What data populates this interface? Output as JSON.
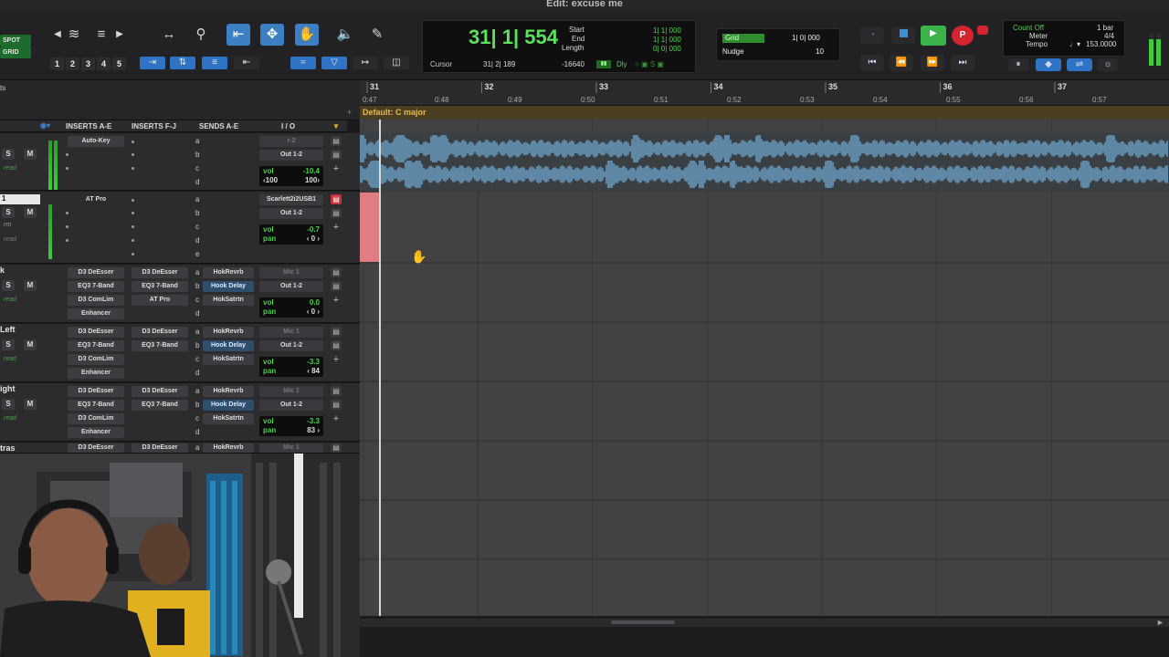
{
  "window": {
    "title": "Edit: excuse me"
  },
  "toolbar": {
    "modes": [
      "SPOT",
      "GRID"
    ],
    "zoom_presets": [
      "1",
      "2",
      "3",
      "4",
      "5"
    ]
  },
  "counter": {
    "main": "31| 1| 554",
    "start_label": "Start",
    "start_value": "1| 1| 000",
    "end_label": "End",
    "end_value": "1| 1| 000",
    "length_label": "Length",
    "length_value": "0| 0| 000",
    "cursor_label": "Cursor",
    "cursor_value": "31| 2| 189",
    "cursor_sample": "-16640",
    "dly_label": "Dly"
  },
  "grid": {
    "grid_label": "Grid",
    "grid_value": "1| 0| 000",
    "nudge_label": "Nudge",
    "nudge_value": "10"
  },
  "meter_panel": {
    "count_off": "Count Off",
    "count_off_value": "1 bar",
    "meter": "Meter",
    "meter_value": "4/4",
    "tempo": "Tempo",
    "tempo_value": "153.0000"
  },
  "ruler": {
    "bars": [
      "31",
      "32",
      "33",
      "34",
      "35",
      "36",
      "37"
    ],
    "times": [
      "0:47",
      "0:48",
      "0:49",
      "0:50",
      "0:51",
      "0:52",
      "0:53",
      "0:54",
      "0:55",
      "0:56",
      "0:57"
    ],
    "chord": "Default: C major",
    "left_label": "ts"
  },
  "mix_header": {
    "inserts_ae": "INSERTS A-E",
    "inserts_fj": "INSERTS F-J",
    "sends_ae": "SENDS A-E",
    "io": "I / O"
  },
  "tracks": [
    {
      "name": "",
      "inserts_ae": [
        "Auto-Key"
      ],
      "inserts_fj": [],
      "sends": [
        "a",
        "b",
        "c",
        "d"
      ],
      "send_boxes": [],
      "io_in": "r-2",
      "io_out": "Out 1-2",
      "vol_label": "vol",
      "vol": "-10.4",
      "pan_left": "‹100",
      "pan_right": "100›",
      "auto": "read"
    },
    {
      "name": "1",
      "inserts_ae": [
        "AT Pro"
      ],
      "inserts_fj": [],
      "sends": [
        "a",
        "b",
        "c",
        "d",
        "e"
      ],
      "send_boxes": [],
      "io_in": "Scarlett2i2USB1",
      "io_out": "Out 1-2",
      "vol_label": "vol",
      "vol": "-0.7",
      "pan_label": "pan",
      "pan": "‹ 0 ›",
      "auto": "read",
      "mode": "rm"
    },
    {
      "name": "k",
      "inserts_ae": [
        "D3 DeEsser",
        "EQ3 7-Band",
        "D3 ComLim",
        "Enhancer"
      ],
      "inserts_fj": [
        "D3 DeEsser",
        "EQ3 7-Band",
        "AT Pro"
      ],
      "sends": [
        "a",
        "b",
        "c",
        "d"
      ],
      "send_boxes": [
        "HokRevrb",
        "Hook Delay",
        "HokSatrtn"
      ],
      "io_in": "Mic 1",
      "io_out": "Out 1-2",
      "vol_label": "vol",
      "vol": "0.0",
      "pan_label": "pan",
      "pan": "‹ 0 ›",
      "auto": "read"
    },
    {
      "name": "Left",
      "inserts_ae": [
        "D3 DeEsser",
        "EQ3 7-Band",
        "D3 ComLim",
        "Enhancer"
      ],
      "inserts_fj": [
        "D3 DeEsser",
        "EQ3 7-Band"
      ],
      "sends": [
        "a",
        "b",
        "c",
        "d"
      ],
      "send_boxes": [
        "HokRevrb",
        "Hook Delay",
        "HokSatrtn"
      ],
      "io_in": "Mic 1",
      "io_out": "Out 1-2",
      "vol_label": "vol",
      "vol": "-3.3",
      "pan_label": "pan",
      "pan": "‹ 84",
      "auto": "read"
    },
    {
      "name": "ight",
      "inserts_ae": [
        "D3 DeEsser",
        "EQ3 7-Band",
        "D3 ComLim",
        "Enhancer"
      ],
      "inserts_fj": [
        "D3 DeEsser",
        "EQ3 7-Band"
      ],
      "sends": [
        "a",
        "b",
        "c",
        "d"
      ],
      "send_boxes": [
        "HokRevrb",
        "Hook Delay",
        "HokSatrtn"
      ],
      "io_in": "Mic 1",
      "io_out": "Out 1-2",
      "vol_label": "vol",
      "vol": "-3.3",
      "pan_label": "pan",
      "pan": "83 ›",
      "auto": "read"
    },
    {
      "name": "tras",
      "inserts_ae": [
        "D3 DeEsser"
      ],
      "inserts_fj": [
        "D3 DeEsser"
      ],
      "sends": [
        "a"
      ],
      "send_boxes": [
        "HokRevrb"
      ],
      "io_in": "Mic 1"
    }
  ],
  "colors": {
    "counter_green": "#5be15b",
    "accent_blue": "#3d7fc3",
    "record_red": "#d4242f",
    "waveform_blue": "#6fa7cf",
    "record_clip_pink": "#e07d82",
    "chord_gold": "#e6b94a"
  },
  "icons": {
    "transport": [
      "rewind-to-start-icon",
      "rewind-icon",
      "fast-forward-icon",
      "go-to-end-icon",
      "stop-icon",
      "play-icon",
      "record-icon"
    ],
    "tools": [
      "trim-tool-icon",
      "selector-tool-icon",
      "grabber-tool-icon",
      "scrubber-tool-icon",
      "pencil-tool-icon",
      "zoom-tool-icon"
    ]
  }
}
